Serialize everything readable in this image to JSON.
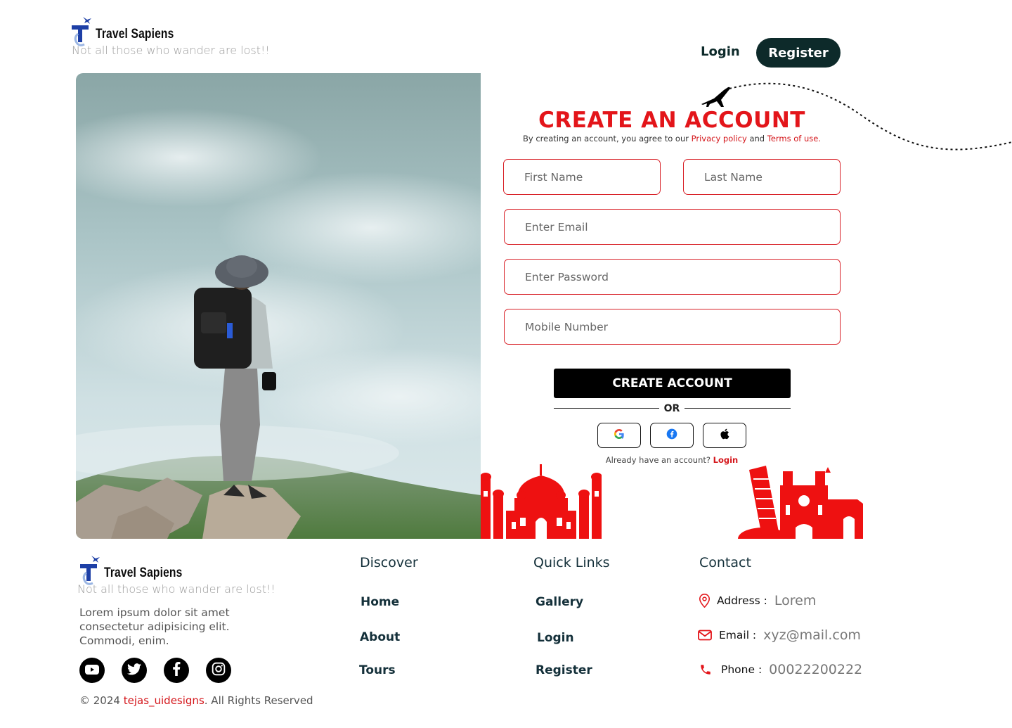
{
  "header": {
    "brand": "Travel Sapiens",
    "tagline": "Not all those who wander are lost!!",
    "login_label": "Login",
    "register_label": "Register"
  },
  "form": {
    "title": "CREATE AN ACCOUNT",
    "agree_prefix": "By creating an account, you agree to our ",
    "privacy_label": "Privacy policy",
    "and_text": " and ",
    "terms_label": "Terms of use.",
    "first_name_placeholder": "First Name",
    "last_name_placeholder": "Last Name",
    "email_placeholder": "Enter Email",
    "password_placeholder": "Enter Password",
    "mobile_placeholder": "Mobile Number",
    "submit_label": "CREATE ACCOUNT",
    "or_text": "OR",
    "have_account_text": "Already have an account? ",
    "have_account_link": "Login"
  },
  "footer": {
    "brand": "Travel Sapiens",
    "tagline": "Not all those who wander are lost!!",
    "description_lines": [
      "Lorem ipsum dolor sit amet",
      "consectetur adipisicing elit.",
      "Commodi, enim."
    ],
    "copyright_prefix": "© 2024 ",
    "copyright_author": "tejas_uidesigns",
    "copyright_suffix": ". All Rights Reserved",
    "discover": {
      "heading": "Discover",
      "links": [
        "Home",
        "About",
        "Tours"
      ]
    },
    "quick_links": {
      "heading": "Quick Links",
      "links": [
        "Gallery",
        "Login",
        "Register"
      ]
    },
    "contact": {
      "heading": "Contact",
      "address_label": "Address :",
      "address_value": "Lorem",
      "email_label": "Email :",
      "email_value": "xyz@mail.com",
      "phone_label": "Phone :",
      "phone_value": "00022200222"
    }
  },
  "colors": {
    "accent_red": "#e3151a",
    "dark_teal": "#0d2a2a"
  },
  "icons": [
    "plane-icon",
    "google-icon",
    "facebook-icon",
    "apple-icon",
    "youtube-icon",
    "twitter-icon",
    "facebook-icon",
    "instagram-icon",
    "location-pin-icon",
    "mail-icon",
    "phone-icon"
  ]
}
